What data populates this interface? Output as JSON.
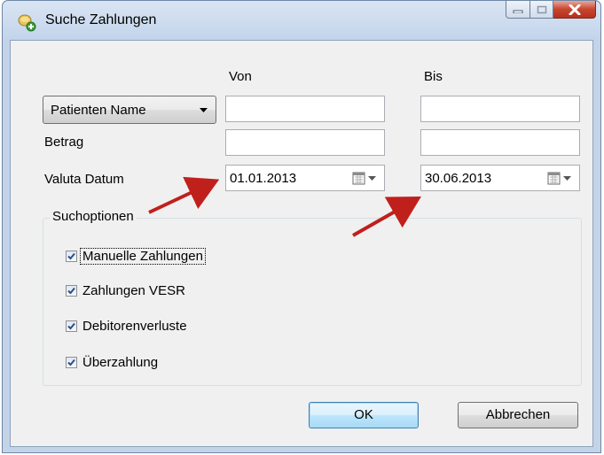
{
  "window": {
    "title": "Suche Zahlungen",
    "icons": {
      "app": "search-payments-icon",
      "minimize": "minimize-icon",
      "maximize": "maximize-icon",
      "close": "close-icon"
    }
  },
  "columns": {
    "from": "Von",
    "to": "Bis"
  },
  "fields": {
    "name_field": {
      "selected": "Patienten Name",
      "from_value": "",
      "to_value": ""
    },
    "amount": {
      "label": "Betrag",
      "from_value": "",
      "to_value": ""
    },
    "value_date": {
      "label": "Valuta Datum",
      "from_value": "01.01.2013",
      "to_value": "30.06.2013"
    }
  },
  "search_options": {
    "title": "Suchoptionen",
    "items": [
      {
        "label": "Manuelle Zahlungen",
        "checked": true
      },
      {
        "label": "Zahlungen VESR",
        "checked": true
      },
      {
        "label": "Debitorenverluste",
        "checked": true
      },
      {
        "label": "Überzahlung",
        "checked": true
      }
    ]
  },
  "buttons": {
    "ok": "OK",
    "cancel": "Abbrechen"
  },
  "annotation": {
    "arrow_color": "#c0201c"
  }
}
